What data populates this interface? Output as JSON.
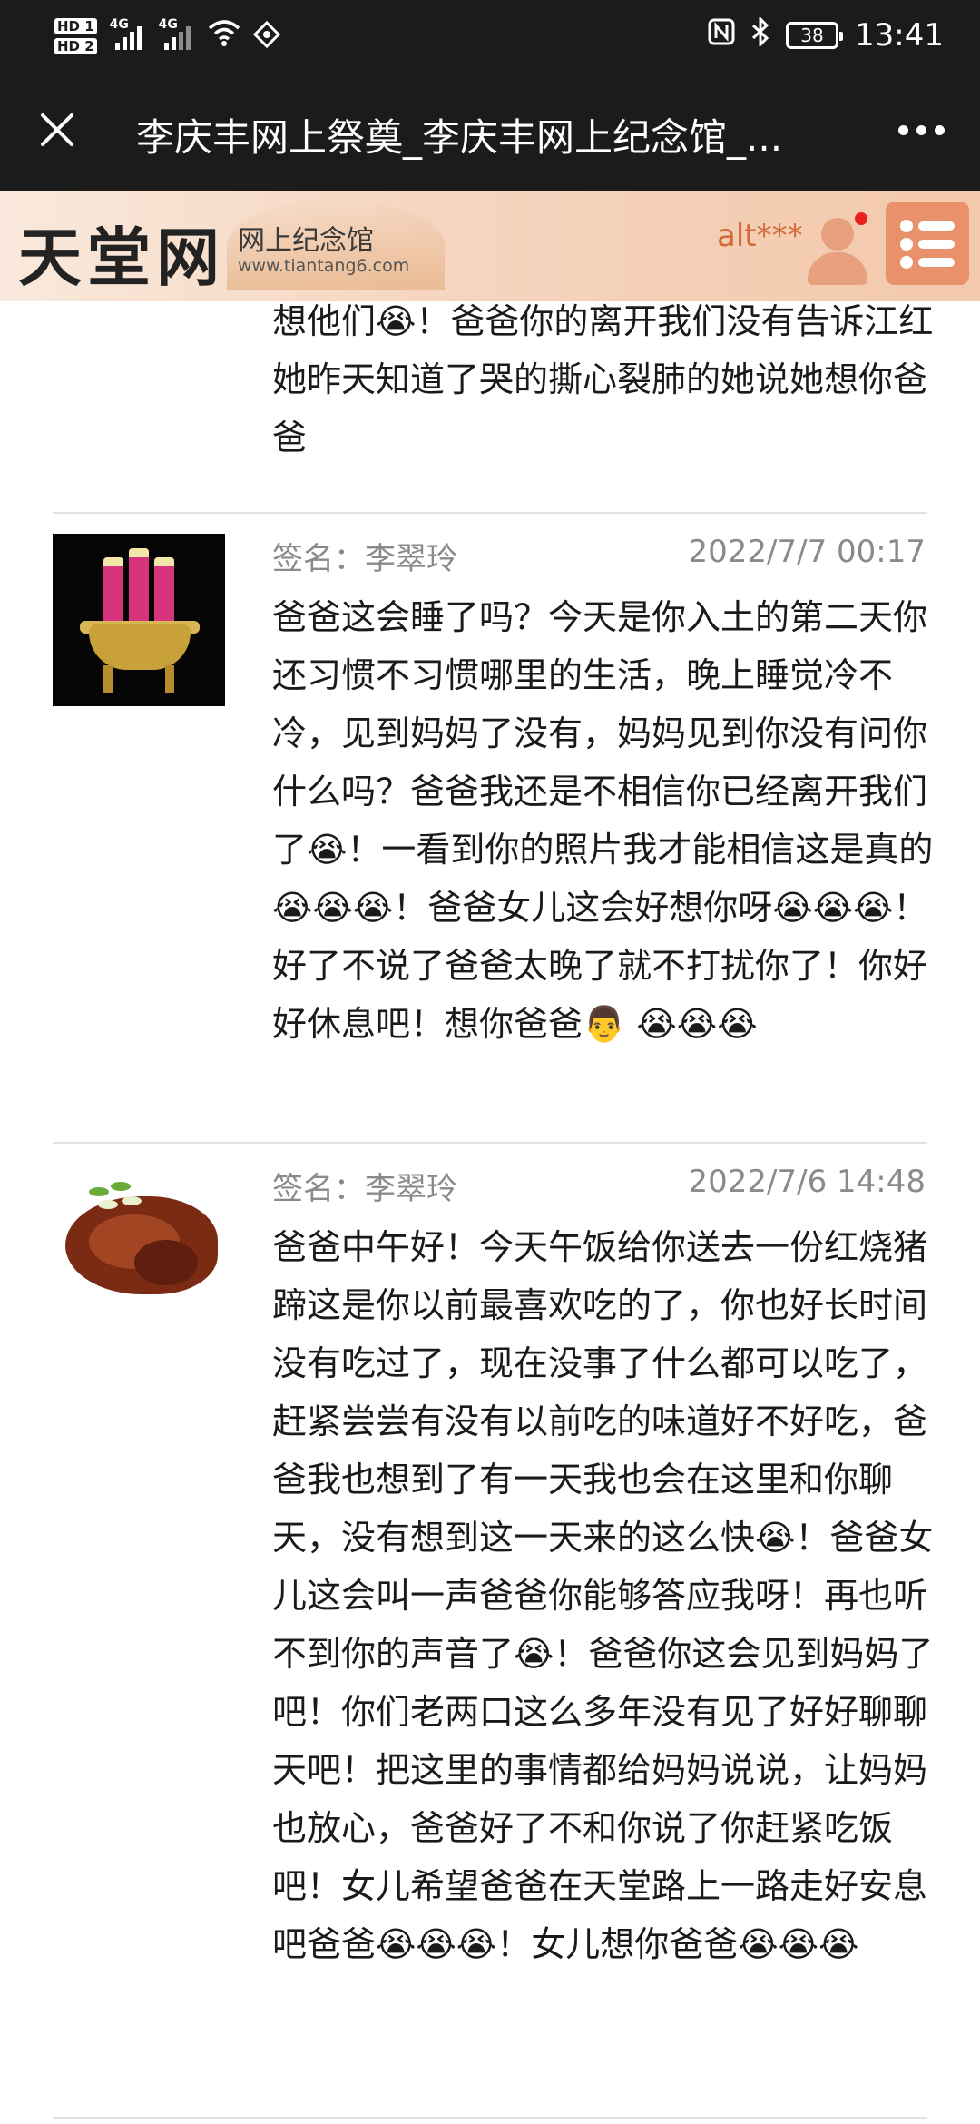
{
  "status_bar": {
    "hd1": "HD 1",
    "hd2": "HD 2",
    "network1": "4G",
    "network2": "4G",
    "battery": "38",
    "time": "13:41",
    "icons": [
      "nfc-icon",
      "bluetooth-icon",
      "wifi-icon",
      "hotspot-icon"
    ]
  },
  "title_bar": {
    "close_icon": "close-icon",
    "title": "李庆丰网上祭奠_李庆丰网上纪念馆_...",
    "more_icon": "more-icon"
  },
  "site_header": {
    "logo": "天堂网",
    "subtitle": "网上纪念馆",
    "url": "www.tiantang6.com",
    "username": "alt***",
    "colors": {
      "accent": "#e9916a",
      "username": "#d36a3a",
      "notification": "#e8201f"
    }
  },
  "messages": [
    {
      "text": "想他们😭！爸爸你的离开我们没有告诉江红她昨天知道了哭的撕心裂肺的她说她想你爸爸"
    },
    {
      "signature_label": "签名：李翠玲",
      "date": "2022/7/7 00:17",
      "avatar": "incense-burner-image",
      "text": "爸爸这会睡了吗？今天是你入土的第二天你还习惯不习惯哪里的生活，晚上睡觉冷不冷，见到妈妈了没有，妈妈见到你没有问你什么吗？爸爸我还是不相信你已经离开我们了😭！一看到你的照片我才能相信这是真的😭😭😭！爸爸女儿这会好想你呀😭😭😭！好了不说了爸爸太晚了就不打扰你了！你好好休息吧！想你爸爸👨 😭😭😭"
    },
    {
      "signature_label": "签名：李翠玲",
      "date": "2022/7/6 14:48",
      "avatar": "braised-pork-image",
      "text": "爸爸中午好！今天午饭给你送去一份红烧猪蹄这是你以前最喜欢吃的了，你也好长时间没有吃过了，现在没事了什么都可以吃了，赶紧尝尝有没有以前吃的味道好不好吃，爸爸我也想到了有一天我也会在这里和你聊天，没有想到这一天来的这么快😭！爸爸女儿这会叫一声爸爸你能够答应我呀！再也听不到你的声音了😭！爸爸你这会见到妈妈了吧！你们老两口这么多年没有见了好好聊聊天吧！把这里的事情都给妈妈说说，让妈妈也放心，爸爸好了不和你说了你赶紧吃饭吧！女儿希望爸爸在天堂路上一路走好安息吧爸爸😭😭😭！女儿想你爸爸😭😭😭"
    }
  ]
}
